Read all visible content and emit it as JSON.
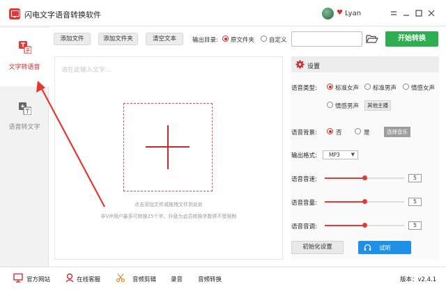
{
  "window": {
    "title": "闪电文字语音转换软件",
    "username": "Lyan",
    "controls": [
      "settings-icon",
      "minimize-icon",
      "maximize-icon",
      "close-icon"
    ]
  },
  "sidebar": {
    "items": [
      {
        "label": "文字转语音",
        "icon": "text-to-speech-icon",
        "active": true
      },
      {
        "label": "语音转文字",
        "icon": "speech-to-text-icon",
        "active": false
      }
    ]
  },
  "toolbar": {
    "add_file": "添加文件",
    "add_folder": "添加文件夹",
    "clear_text": "清空文本",
    "output_dir_label": "输出目录:",
    "output_options": [
      "原文件夹",
      "自定义"
    ],
    "output_selected": "原文件夹",
    "output_path": "",
    "start_button": "开始转换"
  },
  "editor": {
    "placeholder": "请在此输入文字...",
    "hint_add": "点击添加文件或拖拽文件到此处",
    "hint_vip": "非VIP用户最多可转换25个字、升级为会员转换字数将不受限制"
  },
  "settings": {
    "title": "设置",
    "voice_type_label": "语音类型:",
    "voice_types": [
      "标准女声",
      "标准男声",
      "情感女声",
      "情感男声"
    ],
    "voice_type_selected": "标准女声",
    "other_voices_button": "其他主播",
    "bg_label": "语音背景:",
    "bg_options": [
      "否",
      "是"
    ],
    "bg_selected": "否",
    "choose_music_button": "选择音乐",
    "format_label": "输出格式:",
    "format_value": "MP3",
    "speed_label": "语音音速:",
    "speed_value": "5",
    "volume_label": "语音音量:",
    "volume_value": "5",
    "pitch_label": "语音音调:",
    "pitch_value": "5",
    "slider_max": 10,
    "reset_button": "初始化设置",
    "listen_button": "试听"
  },
  "statusbar": {
    "items": [
      {
        "label": "官方网站",
        "icon": "monitor-icon"
      },
      {
        "label": "在线客服",
        "icon": "support-icon"
      },
      {
        "label": "音频剪辑",
        "icon": "scissors-icon"
      },
      {
        "label": "录音",
        "icon": ""
      },
      {
        "label": "音频转换",
        "icon": ""
      }
    ],
    "version_label": "版本：",
    "version": "v2.4.1"
  },
  "colors": {
    "accent_red": "#e53935",
    "start_green": "#2eae50",
    "listen_blue": "#1e90e6",
    "annotation_arrow": "#e8352f"
  }
}
